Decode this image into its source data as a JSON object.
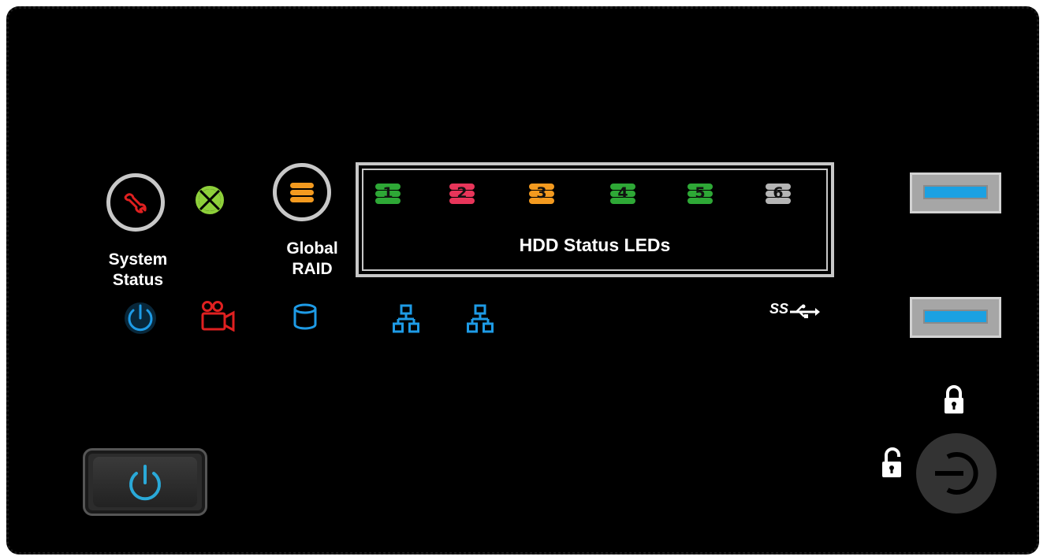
{
  "panel": {
    "labels": {
      "system_status_line1": "System",
      "system_status_line2": "Status",
      "global_raid_line1": "Global",
      "global_raid_line2": "RAID",
      "hdd_status_title": "HDD Status LEDs"
    },
    "hdd_leds": [
      {
        "number": "1",
        "color": "#2ea836"
      },
      {
        "number": "2",
        "color": "#e8355a"
      },
      {
        "number": "3",
        "color": "#f39a1f"
      },
      {
        "number": "4",
        "color": "#2ea836"
      },
      {
        "number": "5",
        "color": "#2ea836"
      },
      {
        "number": "6",
        "color": "#b5b5b5"
      }
    ],
    "icons": {
      "system_status": {
        "name": "wrench-icon",
        "color": "#e02020"
      },
      "fan": {
        "name": "fan-icon",
        "color": "#8ed03a"
      },
      "global_raid": {
        "name": "database-stack-icon",
        "color": "#f39a1f"
      },
      "power_led": {
        "name": "power-icon",
        "color": "#1e9be6"
      },
      "camera": {
        "name": "video-camera-icon",
        "color": "#e02020"
      },
      "storage": {
        "name": "cylinder-icon",
        "color": "#1e9be6"
      },
      "lan1": {
        "name": "network-icon",
        "color": "#1e9be6"
      },
      "lan2": {
        "name": "network-icon",
        "color": "#1e9be6"
      },
      "usb3": {
        "name": "usb-superspeed-icon",
        "color": "#ffffff"
      },
      "lock": {
        "name": "lock-closed-icon",
        "color": "#ffffff"
      },
      "unlock": {
        "name": "lock-open-icon",
        "color": "#ffffff"
      }
    },
    "usb_ports": [
      "usb-port-1",
      "usb-port-2"
    ],
    "usb_logo_text": "SS"
  }
}
